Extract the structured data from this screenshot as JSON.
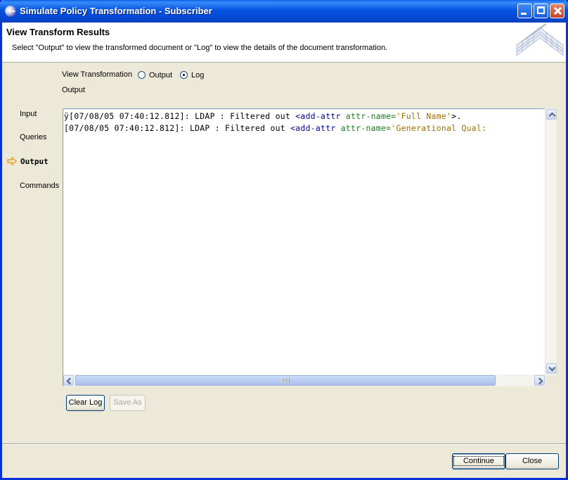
{
  "window": {
    "title": "Simulate Policy Transformation - Subscriber"
  },
  "header": {
    "title": "View Transform Results",
    "description": "Select \"Output\" to view the transformed document or \"Log\" to view the details of the document transformation."
  },
  "steps": [
    {
      "label": "Input",
      "active": false
    },
    {
      "label": "Queries",
      "active": false
    },
    {
      "label": "Output",
      "active": true
    },
    {
      "label": "Commands",
      "active": false
    }
  ],
  "view": {
    "label": "View Transformation",
    "options": [
      {
        "label": "Output",
        "checked": false
      },
      {
        "label": "Log",
        "checked": true
      }
    ],
    "section_label": "Output"
  },
  "log": {
    "lines": [
      {
        "prefix": "ÿ[07/08/05 07:40:12.812]: LDAP :   Filtered out ",
        "tag": "<add-attr",
        "attr": " attr-name=",
        "value": "'Full Name'",
        "suffix": ">."
      },
      {
        "prefix": "[07/08/05 07:40:12.812]: LDAP :   Filtered out ",
        "tag": "<add-attr",
        "attr": " attr-name=",
        "value": "'Generational Qual:",
        "suffix": ""
      }
    ]
  },
  "buttons": {
    "clear_log": "Clear Log",
    "save_as": "Save As",
    "continue": "Continue",
    "close": "Close"
  },
  "icons": {
    "app": "eclipse-icon",
    "active_step": "arrow-right-icon",
    "header": "wireframe-graphic-icon"
  },
  "colors": {
    "titlebar": "#0454e3",
    "xml_tag": "#0000a0",
    "xml_attr": "#1a7e1a",
    "xml_value": "#a07000",
    "active_arrow": "#e8a020"
  }
}
